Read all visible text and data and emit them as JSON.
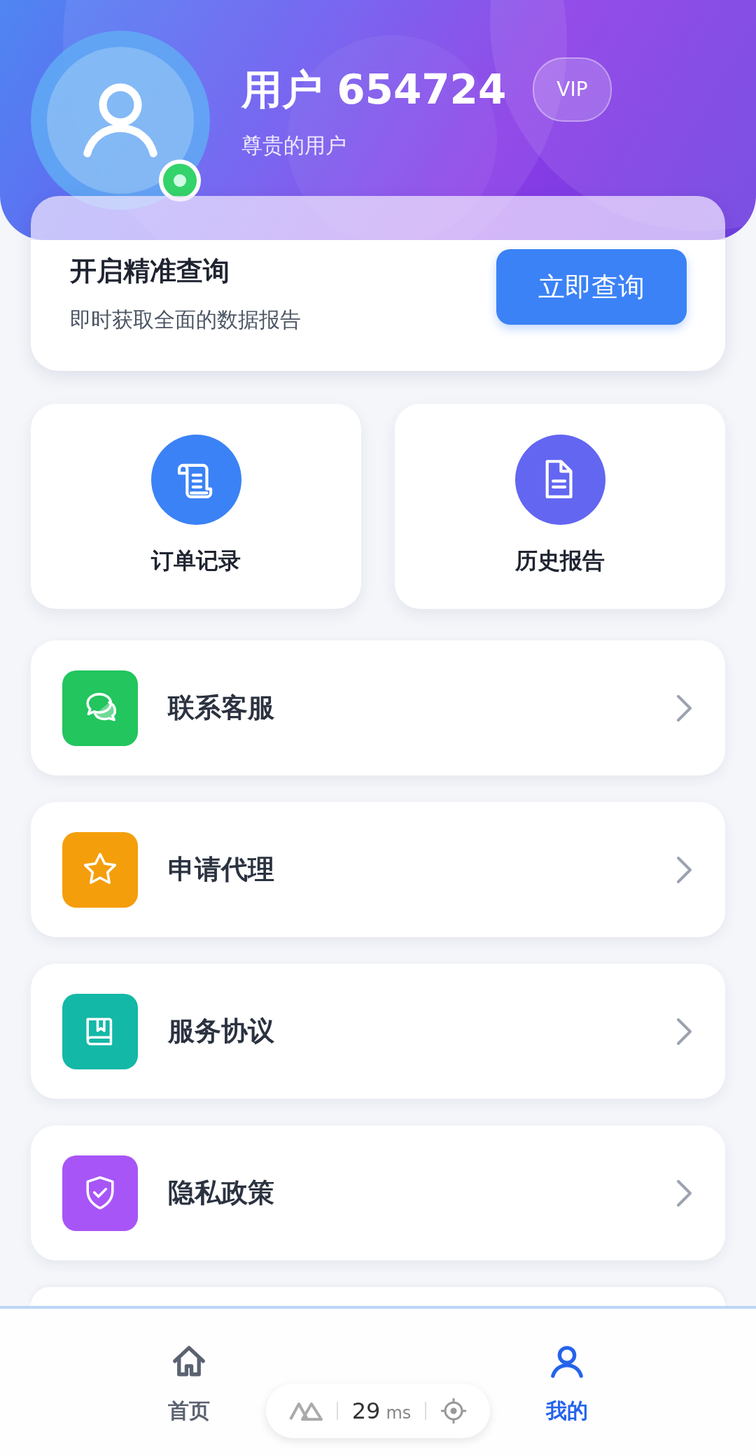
{
  "header": {
    "user_name": "用户 654724",
    "badge": "VIP",
    "subtitle": "尊贵的用户",
    "online": true
  },
  "query_card": {
    "title": "开启精准查询",
    "subtitle": "即时获取全面的数据报告",
    "button": "立即查询"
  },
  "shortcuts": [
    {
      "label": "订单记录",
      "kind": "scroll",
      "color": "#3b82f6"
    },
    {
      "label": "历史报告",
      "kind": "document",
      "color": "#6366f1"
    }
  ],
  "menu": [
    {
      "label": "联系客服",
      "kind": "chat",
      "color": "#22c55e"
    },
    {
      "label": "申请代理",
      "kind": "star",
      "color": "#f59e0b"
    },
    {
      "label": "服务协议",
      "kind": "book",
      "color": "#14b8a6"
    },
    {
      "label": "隐私政策",
      "kind": "shield",
      "color": "#a855f7"
    }
  ],
  "tab_bar": [
    {
      "label": "首页",
      "kind": "home",
      "selected": false
    },
    {
      "label": "我的",
      "kind": "user",
      "selected": true
    }
  ],
  "debug_pill": {
    "value": "29",
    "unit": "ms"
  }
}
